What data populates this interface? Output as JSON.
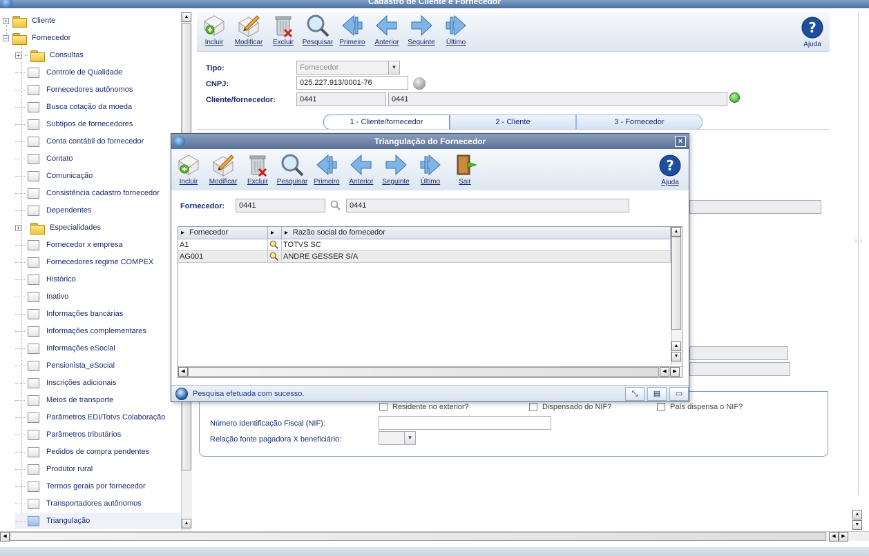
{
  "window": {
    "title": "Cadastro de Cliente e Fornecedor"
  },
  "tree": {
    "roots": [
      {
        "label": "Cliente",
        "expander": "+"
      },
      {
        "label": "Fornecedor",
        "expander": "−"
      }
    ],
    "children": [
      {
        "label": "Consultas",
        "type": "folder"
      },
      {
        "label": "Controle de Qualidade",
        "type": "doc"
      },
      {
        "label": "Fornecedores autônomos",
        "type": "doc"
      },
      {
        "label": "Busca cotação da moeda",
        "type": "doc"
      },
      {
        "label": "Subtipos de fornecedores",
        "type": "doc"
      },
      {
        "label": "Conta contábil do fornecedor",
        "type": "doc"
      },
      {
        "label": "Contato",
        "type": "doc"
      },
      {
        "label": "Comunicação",
        "type": "doc"
      },
      {
        "label": "Consistência cadastro fornecedor",
        "type": "doc"
      },
      {
        "label": "Dependentes",
        "type": "doc"
      },
      {
        "label": "Especialidades",
        "type": "folder"
      },
      {
        "label": "Fornecedor x empresa",
        "type": "doc"
      },
      {
        "label": "Fornecedores regime COMPEX",
        "type": "doc"
      },
      {
        "label": "Histórico",
        "type": "doc"
      },
      {
        "label": "Inativo",
        "type": "doc"
      },
      {
        "label": "Informações bancárias",
        "type": "doc"
      },
      {
        "label": "Informações complementares",
        "type": "doc"
      },
      {
        "label": "Informações eSocial",
        "type": "doc"
      },
      {
        "label": "Pensionista_eSocial",
        "type": "doc"
      },
      {
        "label": "Inscrições adicionais",
        "type": "doc"
      },
      {
        "label": "Meios de transporte",
        "type": "doc"
      },
      {
        "label": "Parâmetros EDI/Totvs Colaboração",
        "type": "doc"
      },
      {
        "label": "Parâmetros tributários",
        "type": "doc"
      },
      {
        "label": "Pedidos de compra pendentes",
        "type": "doc"
      },
      {
        "label": "Produtor rural",
        "type": "doc"
      },
      {
        "label": "Termos gerais por fornecedor",
        "type": "doc"
      },
      {
        "label": "Transportadores autônomos",
        "type": "doc"
      },
      {
        "label": "Triangulação",
        "type": "doc",
        "selected": true
      }
    ]
  },
  "toolbar": {
    "buttons": [
      "Incluir",
      "Modificar",
      "Excluir",
      "Pesquisar",
      "Primeiro",
      "Anterior",
      "Seguinte",
      "Último"
    ],
    "help": "Ajuda"
  },
  "form": {
    "tipo_label": "Tipo:",
    "tipo_value": "Fornecedor",
    "cnpj_label": "CNPJ:",
    "cnpj_value": "025.227.913/0001-76",
    "cf_label": "Cliente/fornecedor:",
    "cf_code": "0441",
    "cf_name": "0441"
  },
  "tabs": [
    "1 - Cliente/fornecedor",
    "2 - Cliente",
    "3 - Fornecedor"
  ],
  "lower": {
    "residente": "Residente no exterior?",
    "dispensado": "Dispensado do NIF?",
    "pais_dispensa": "País dispensa o NIF?",
    "nif_label": "Número Identificação Fiscal (NIF):",
    "relacao_label": "Relação fonte pagadora X beneficiário:"
  },
  "dialog": {
    "title": "Triangulação do Fornecedor",
    "toolbar": [
      "Incluir",
      "Modificar",
      "Excluir",
      "Pesquisar",
      "Primeiro",
      "Anterior",
      "Seguinte",
      "Último",
      "Sair"
    ],
    "help": "Ajuda",
    "fornecedor_label": "Fornecedor:",
    "fornecedor_code": "0441",
    "fornecedor_name": "0441",
    "grid": {
      "columns": [
        "Fornecedor",
        "Razão social do fornecedor"
      ],
      "rows": [
        {
          "code": "A1",
          "name": "TOTVS SC"
        },
        {
          "code": "AG001",
          "name": "ANDRE GESSER S/A"
        }
      ]
    },
    "status": "Pesquisa efetuada com sucesso."
  },
  "colors": {
    "accent": "#1a2a6c",
    "title_bar": "#5a7196",
    "selected_row": "#eef1f7"
  }
}
